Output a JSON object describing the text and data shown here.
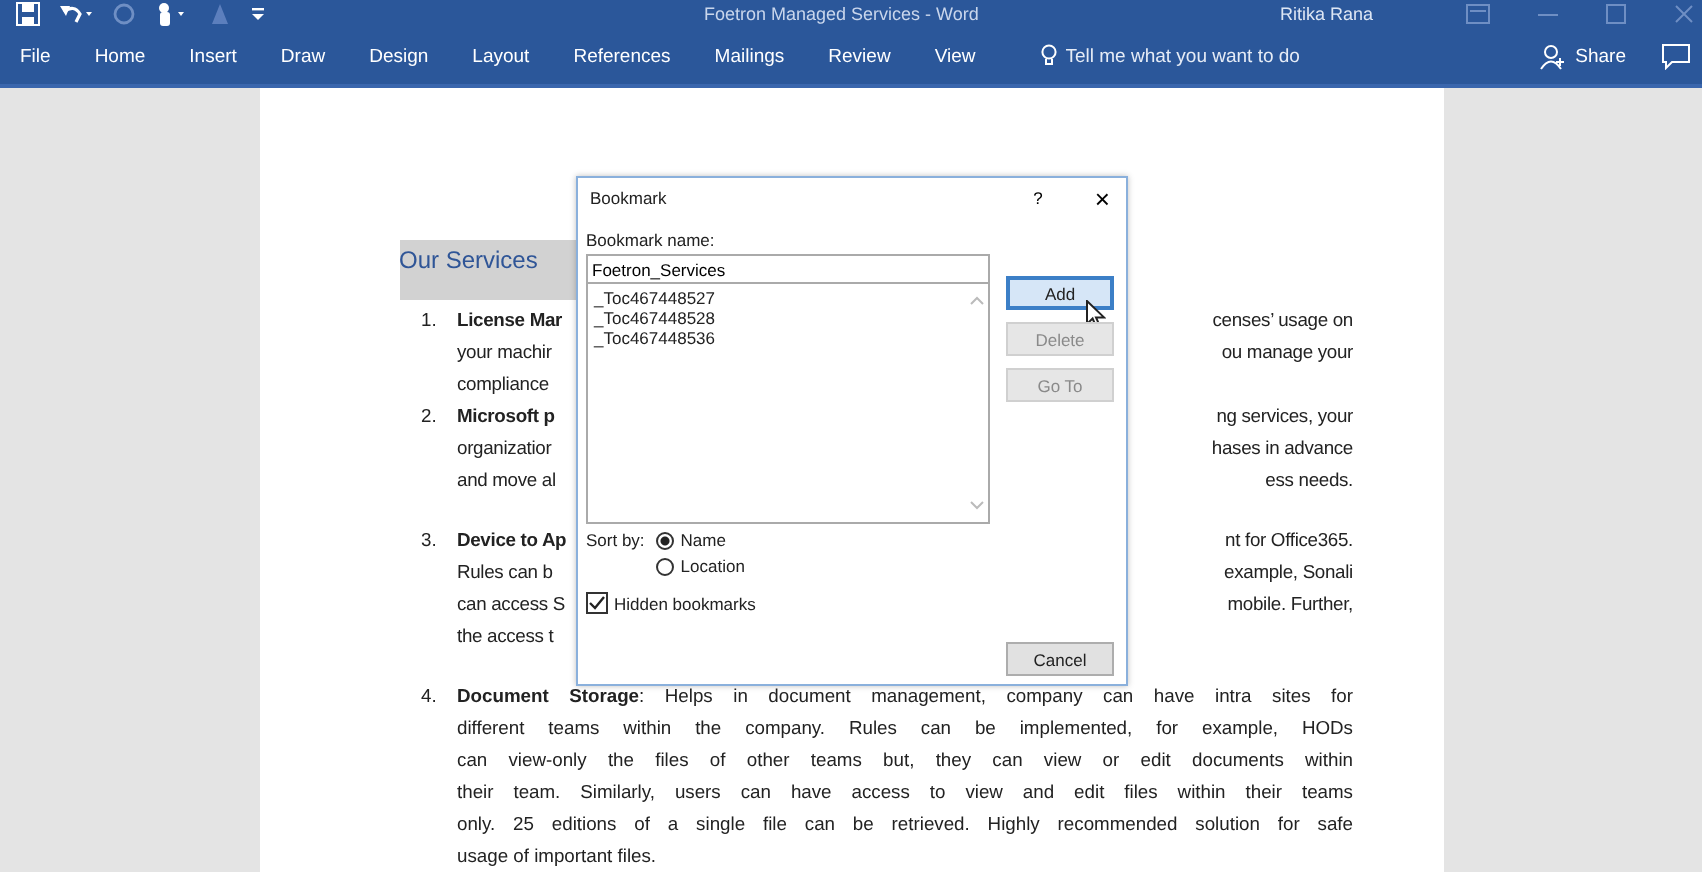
{
  "window": {
    "title": "Foetron Managed Services  -  Word",
    "user": "Ritika Rana"
  },
  "tabs": [
    {
      "label": "File",
      "selected": false
    },
    {
      "label": "Home",
      "selected": false
    },
    {
      "label": "Insert",
      "selected": false
    },
    {
      "label": "Draw",
      "selected": false
    },
    {
      "label": "Design",
      "selected": false
    },
    {
      "label": "Layout",
      "selected": false
    },
    {
      "label": "References",
      "selected": false
    },
    {
      "label": "Mailings",
      "selected": false
    },
    {
      "label": "Review",
      "selected": false
    },
    {
      "label": "View",
      "selected": false
    }
  ],
  "tell_me": {
    "placeholder": "Tell me what you want to do"
  },
  "share": "Share",
  "document": {
    "heading": "Our Services",
    "items": [
      {
        "number": "1.",
        "gap_before": false,
        "lines": [
          {
            "left": "License Mar",
            "right": "censes’ usage on",
            "bold": true
          },
          {
            "left": "your machir",
            "right": "ou manage your",
            "bold": false
          },
          {
            "left": "compliance",
            "bold": false
          }
        ]
      },
      {
        "number": "2.",
        "gap_before": false,
        "lines": [
          {
            "left": "Microsoft p",
            "right": "ng services, your",
            "bold": true
          },
          {
            "left": "organizatior",
            "right": "hases in advance",
            "bold": false
          },
          {
            "left": "and move al",
            "right": "ess needs.",
            "bold": false
          }
        ]
      },
      {
        "number": "3.",
        "gap_before": true,
        "lines": [
          {
            "left": "Device to Ap",
            "right": "nt for Office365.",
            "bold": true
          },
          {
            "left": "Rules can b",
            "right": "example, Sonali",
            "bold": false
          },
          {
            "left": "can access S",
            "right": "mobile. Further,",
            "bold": false
          },
          {
            "left": "the access t",
            "bold": false
          }
        ]
      },
      {
        "number": "4.",
        "gap_before": true,
        "lines": [
          {
            "text": "**Document Storage**: Helps in document management, company can have intra sites for"
          },
          {
            "text": "different teams within the company. Rules can be implemented, for example, HODs"
          },
          {
            "text": "can view-only the files of other teams but, they can view or edit documents within"
          },
          {
            "text": "their team. Similarly, users can have access to view and edit files within their teams"
          },
          {
            "text": "only. 25 editions of a single file can be retrieved. Highly recommended solution for safe"
          },
          {
            "text": "usage of important files."
          }
        ]
      }
    ]
  },
  "dialog": {
    "title": "Bookmark",
    "help": "?",
    "close": "×",
    "name_label": "Bookmark name:",
    "name_value": "Foetron_Services",
    "bookmarks": [
      "_Toc467448527",
      "_Toc467448528",
      "_Toc467448536"
    ],
    "buttons": [
      {
        "label": "Add",
        "disabled": false,
        "focused": true
      },
      {
        "label": "Delete",
        "disabled": true,
        "focused": false
      },
      {
        "label": "Go To",
        "disabled": true,
        "focused": false
      }
    ],
    "sort_label": "Sort by:",
    "sort_options": [
      {
        "label": "Name",
        "selected": true
      },
      {
        "label": "Location",
        "selected": false
      }
    ],
    "hidden": {
      "label": "Hidden bookmarks",
      "checked": true
    },
    "cancel": "Cancel"
  }
}
